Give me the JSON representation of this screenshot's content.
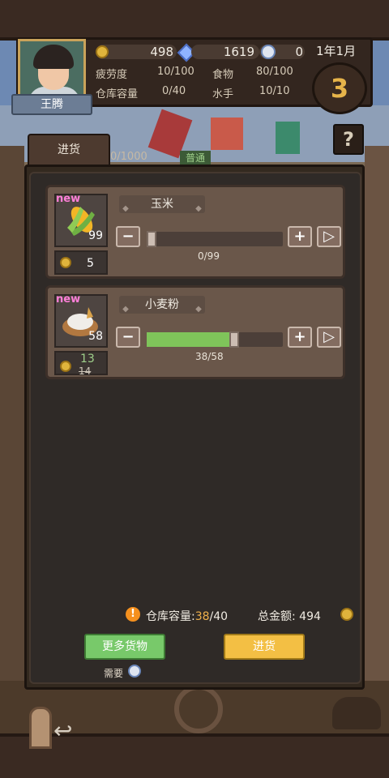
{
  "player": {
    "name": "王腾",
    "gold": "498",
    "gems": "1619",
    "badges": "0",
    "date": "1年1月",
    "level": "3"
  },
  "stats": {
    "fatigue_label": "疲劳度",
    "fatigue_value": "10/100",
    "food_label": "食物",
    "food_value": "80/100",
    "warehouse_label": "仓库容量",
    "warehouse_value": "0/40",
    "sailors_label": "水手",
    "sailors_value": "10/10"
  },
  "help_label": "?",
  "tab": {
    "label": "进货",
    "capacity": "0/1000",
    "tag": "普通"
  },
  "items": [
    {
      "new_label": "new",
      "name": "玉米",
      "stock": "99",
      "price": "5",
      "old_price": "",
      "selected": 0,
      "max": 99,
      "progress_label": "0/99"
    },
    {
      "new_label": "new",
      "name": "小麦粉",
      "stock": "58",
      "price": "13",
      "old_price": "14",
      "selected": 38,
      "max": 58,
      "progress_label": "38/58"
    }
  ],
  "controls": {
    "minus": "−",
    "plus": "+",
    "max": "▷"
  },
  "summary": {
    "warning_icon": "!",
    "capacity_label": "仓库容量:",
    "capacity_used": "38",
    "capacity_total": "/40",
    "total_label": "总金额:",
    "total_value": "494"
  },
  "buttons": {
    "more_goods": "更多货物",
    "purchase": "进货",
    "requirement_label": "需要"
  },
  "colors": {
    "accent_gold": "#e0b43c",
    "slider_fill": "#7fc45a",
    "new_tag": "#ff7fd8",
    "highlight": "#f0b14b"
  }
}
